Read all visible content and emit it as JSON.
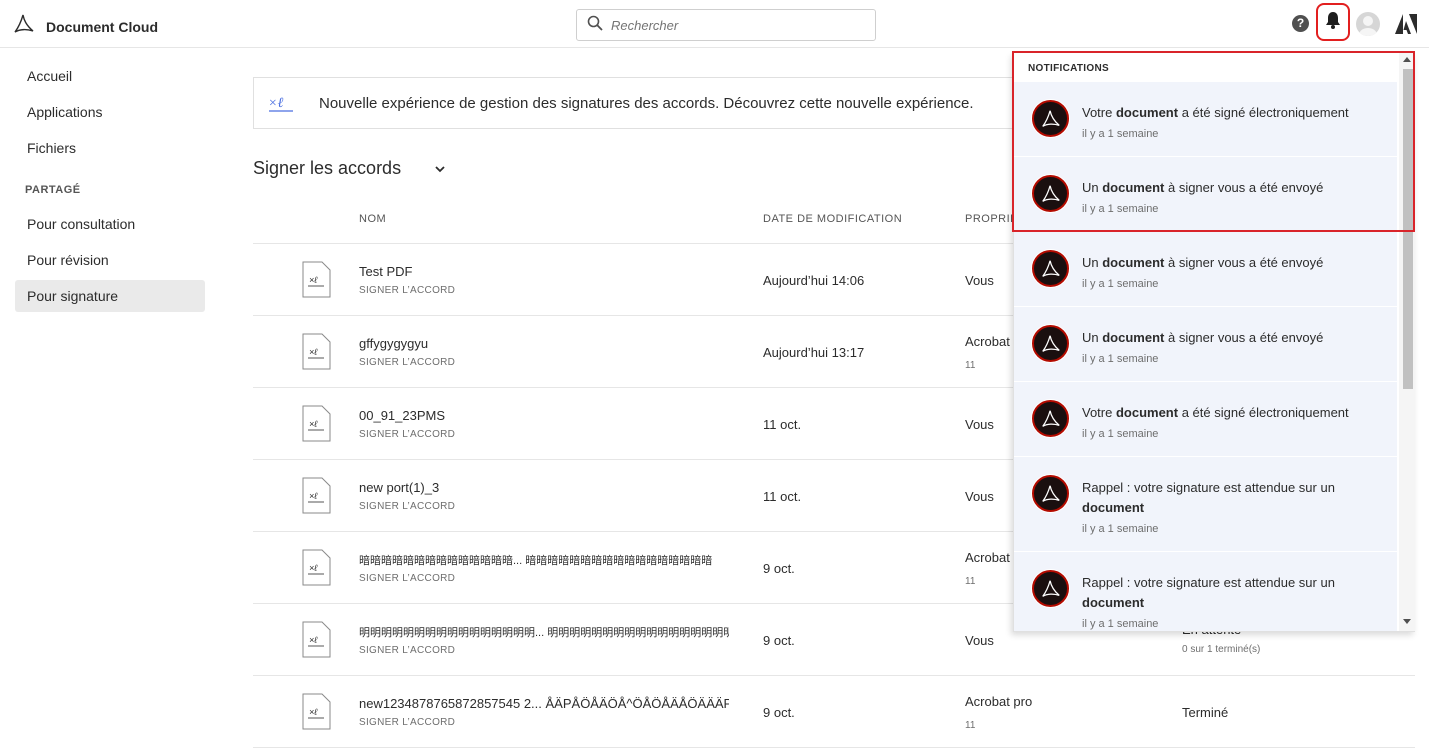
{
  "header": {
    "app_title": "Document Cloud",
    "search_placeholder": "Rechercher",
    "help_glyph": "?",
    "icons": [
      "acrobat-logo-icon",
      "search-icon",
      "help-icon",
      "bell-icon",
      "avatar-icon",
      "adobe-icon"
    ]
  },
  "sidebar": {
    "items": [
      {
        "label": "Accueil"
      },
      {
        "label": "Applications"
      },
      {
        "label": "Fichiers"
      }
    ],
    "section_label": "PARTAGÉ",
    "shared_items": [
      {
        "label": "Pour consultation"
      },
      {
        "label": "Pour révision"
      },
      {
        "label": "Pour signature",
        "active": true
      }
    ]
  },
  "banner": {
    "text": "Nouvelle expérience de gestion des signatures des accords. Découvrez cette nouvelle expérience.",
    "icon": "sign-icon"
  },
  "main": {
    "section_title": "Signer les accords",
    "columns": {
      "name": "NOM",
      "date": "DATE DE MODIFICATION",
      "owner": "PROPRIÉTAIRE"
    },
    "rows": [
      {
        "name": "Test PDF",
        "sub": "SIGNER L’ACCORD",
        "date": "Aujourd’hui 14:06",
        "owner": "Vous",
        "owner_sub": "",
        "status": "",
        "status_sub": ""
      },
      {
        "name": "gffygygygyu",
        "sub": "SIGNER L’ACCORD",
        "date": "Aujourd’hui 13:17",
        "owner": "Acrobat",
        "owner_sub": "11",
        "status": "",
        "status_sub": ""
      },
      {
        "name": "00_91_23PMS",
        "sub": "SIGNER L’ACCORD",
        "date": "11 oct.",
        "owner": "Vous",
        "owner_sub": "",
        "status": "",
        "status_sub": ""
      },
      {
        "name": "new port(1)_3",
        "sub": "SIGNER L’ACCORD",
        "date": "11 oct.",
        "owner": "Vous",
        "owner_sub": "",
        "status": "",
        "status_sub": ""
      },
      {
        "name": "暗暗暗暗暗暗暗暗暗暗暗暗暗暗... 暗暗暗暗暗暗暗暗暗暗暗暗暗暗暗暗暗",
        "sub": "SIGNER L’ACCORD",
        "date": "9 oct.",
        "owner": "Acrobat",
        "owner_sub": "11",
        "status": "",
        "status_sub": ""
      },
      {
        "name": "明明明明明明明明明明明明明明明明... 明明明明明明明明明明明明明明明明明",
        "sub": "SIGNER L’ACCORD",
        "date": "9 oct.",
        "owner": "Vous",
        "owner_sub": "",
        "status": "En attente",
        "status_sub": "0 sur 1 terminé(s)"
      },
      {
        "name": "new1234878765872857545 2... ÅÄPÅÖÅÄÖÅ^ÖÅÖÅÄÅÖÄÄÄPÖÄ",
        "sub": "SIGNER L’ACCORD",
        "date": "9 oct.",
        "owner": "Acrobat pro",
        "owner_sub": "11",
        "status": "Terminé",
        "status_sub": ""
      }
    ]
  },
  "notifications": {
    "header": "NOTIFICATIONS",
    "items": [
      {
        "pre": "Votre ",
        "bold": "document",
        "post": " a été signé électroniquement",
        "time": "il y a 1 semaine"
      },
      {
        "pre": "Un ",
        "bold": "document",
        "post": " à signer vous a été envoyé",
        "time": "il y a 1 semaine"
      },
      {
        "pre": "Un ",
        "bold": "document",
        "post": " à signer vous a été envoyé",
        "time": "il y a 1 semaine"
      },
      {
        "pre": "Un ",
        "bold": "document",
        "post": " à signer vous a été envoyé",
        "time": "il y a 1 semaine"
      },
      {
        "pre": "Votre ",
        "bold": "document",
        "post": " a été signé électroniquement",
        "time": "il y a 1 semaine"
      },
      {
        "pre": "Rappel : votre signature est attendue sur un ",
        "bold": "document",
        "post": "",
        "time": "il y a 1 semaine"
      },
      {
        "pre": "Rappel : votre signature est attendue sur un ",
        "bold": "document",
        "post": "",
        "time": "il y a 1 semaine"
      }
    ]
  },
  "colors": {
    "accent_red": "#d9242a",
    "notif_bg": "#f1f4fb",
    "acrobat_red": "#b30b00"
  }
}
